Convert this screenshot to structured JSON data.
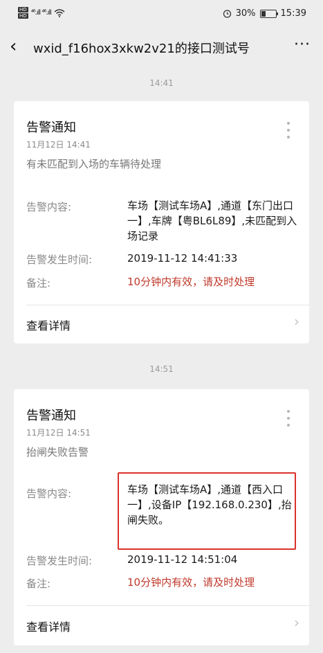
{
  "status_bar": {
    "hd1": "HD",
    "hd2": "HD",
    "signal": "⁴⁶.ıll ⁴⁶.ıll",
    "wifi": "WiFi",
    "battery_percent": "30%",
    "time": "15:39"
  },
  "nav": {
    "title": "wxid_f16hox3xkw2v21的接口测试号",
    "more": "···"
  },
  "messages": [
    {
      "timestamp": "14:41",
      "title": "告警通知",
      "date": "11月12日 14:41",
      "subtitle": "有未匹配到入场的车辆待处理",
      "content_label": "告警内容:",
      "content": "车场【测试车场A】,通道【东门出口一】,车牌【粤BL6L89】,未匹配到入场记录",
      "time_label": "告警发生时间:",
      "time_value": "2019-11-12 14:41:33",
      "note_label": "备注:",
      "note_value": "10分钟内有效，请及时处理",
      "detail_label": "查看详情"
    },
    {
      "timestamp": "14:51",
      "title": "告警通知",
      "date": "11月12日 14:51",
      "subtitle": "抬闸失败告警",
      "content_label": "告警内容:",
      "content": "车场【测试车场A】,通道【西入口一】,设备IP【192.168.0.230】,抬闸失败。",
      "time_label": "告警发生时间:",
      "time_value": "2019-11-12 14:51:04",
      "note_label": "备注:",
      "note_value": "10分钟内有效，请及时处理",
      "detail_label": "查看详情"
    }
  ],
  "colors": {
    "background": "#ededed",
    "card": "#ffffff",
    "note_red": "#c0392b",
    "highlight_red": "#d9312b"
  }
}
